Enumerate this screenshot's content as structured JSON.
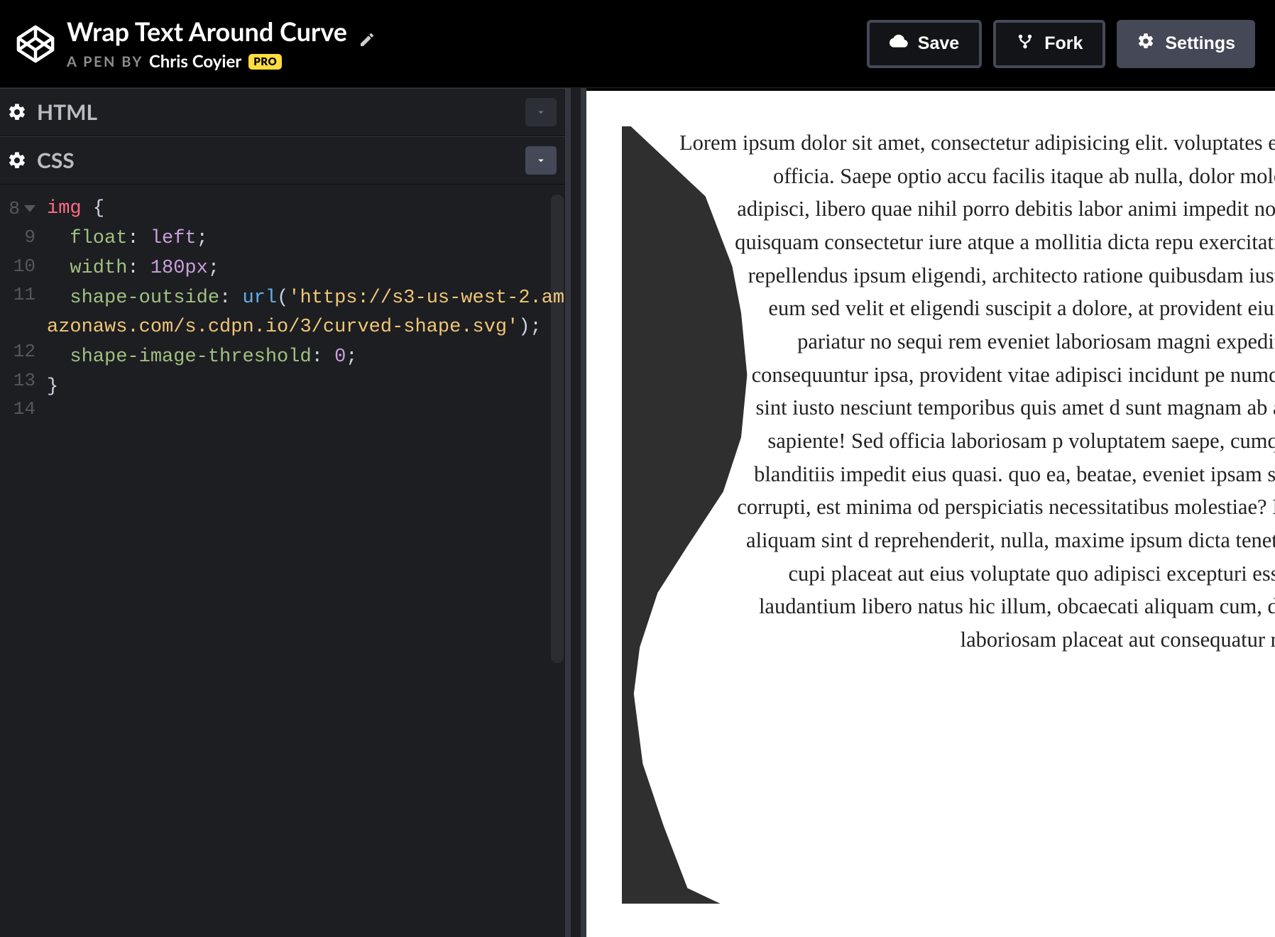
{
  "header": {
    "pen_title": "Wrap Text Around Curve",
    "byline_prefix": "A PEN BY",
    "author": "Chris Coyier",
    "pro_badge": "PRO",
    "buttons": {
      "save": "Save",
      "fork": "Fork",
      "settings": "Settings"
    }
  },
  "panels": {
    "html": {
      "title": "HTML"
    },
    "css": {
      "title": "CSS"
    }
  },
  "code": {
    "line_start": 8,
    "lines": [
      {
        "n": 8,
        "fold": true,
        "html": "<span class='tok-sel'>img</span> <span class='tok-punc'>{</span>"
      },
      {
        "n": 9,
        "html": "  <span class='tok-prop'>float</span><span class='tok-punc'>:</span> <span class='tok-val'>left</span><span class='tok-punc'>;</span>"
      },
      {
        "n": 10,
        "html": "  <span class='tok-prop'>width</span><span class='tok-punc'>:</span> <span class='tok-num'>180px</span><span class='tok-punc'>;</span>"
      },
      {
        "n": 11,
        "html": "  <span class='tok-prop'>shape-outside</span><span class='tok-punc'>:</span> <span class='tok-fn'>url</span><span class='tok-punc'>(</span><span class='tok-str'>'https://s3-us-west-2.amazonaws.com/s.cdpn.io/3/curved-shape.svg'</span><span class='tok-punc'>);</span>"
      },
      {
        "n": 12,
        "html": "  <span class='tok-prop'>shape-image-threshold</span><span class='tok-punc'>:</span> <span class='tok-num'>0</span><span class='tok-punc'>;</span>"
      },
      {
        "n": 13,
        "html": "<span class='tok-punc'>}</span>"
      },
      {
        "n": 14,
        "html": ""
      }
    ]
  },
  "preview": {
    "text": "Lorem ipsum dolor sit amet, consectetur adipisicing elit. voluptates enim, distinctio officia. Saepe optio accu facilis itaque ab nulla, dolor molestiae assumen adipisci, libero quae nihil porro debitis labor animi impedit nostrum nesciunt quisquam consectetur iure atque a mollitia dicta repu exercitationem aliquam repellendus ipsum eligendi, architecto ratione quibusdam iusto inventore ea eum sed velit et eligendi suscipit a dolore, at provident eius alias maxime pariatur no sequi rem eveniet laboriosam magni expedita? Maiore iste consequuntur ipsa, provident vitae adipisci incidunt pe numquam blanditiis sint iusto nesciunt temporibus quis amet d sunt magnam ab animi aperiam, sapiente! Sed officia laboriosam p voluptatem saepe, cumque consectetur blanditiis impedit eius quasi. quo ea, beatae, eveniet ipsam sunt accusamus corrupti, est minima od perspiciatis necessitatibus molestiae? Incidunt omnis aliquam sint d reprehenderit, nulla, maxime ipsum dicta tenetur et possimus cupi placeat aut eius voluptate quo adipisci excepturi esse atque evenie laudantium libero natus hic illum, obcaecati aliquam cum, delec reiciendis laboriosam placeat aut consequatur ratione soluta e"
  }
}
